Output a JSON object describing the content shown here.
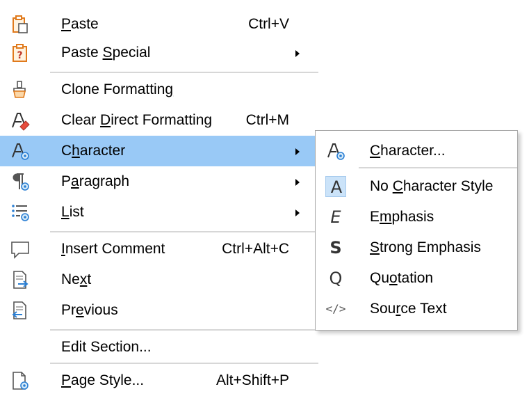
{
  "main_menu": {
    "items": [
      {
        "pre": "",
        "acc": "P",
        "post": "aste",
        "shortcut": "Ctrl+V",
        "icon": "paste-icon",
        "submenu": false
      },
      {
        "pre": "Paste ",
        "acc": "S",
        "post": "pecial",
        "shortcut": "",
        "icon": "paste-special-icon",
        "submenu": true
      },
      {
        "pre": "Clone Formattin",
        "acc": "g",
        "post": "",
        "shortcut": "",
        "icon": "clone-formatting-icon",
        "submenu": false
      },
      {
        "pre": "Clear ",
        "acc": "D",
        "post": "irect Formatting",
        "shortcut": "Ctrl+M",
        "icon": "clear-formatting-icon",
        "submenu": false
      },
      {
        "pre": "C",
        "acc": "h",
        "post": "aracter",
        "shortcut": "",
        "icon": "character-icon",
        "submenu": true,
        "highlighted": true
      },
      {
        "pre": "P",
        "acc": "a",
        "post": "ragraph",
        "shortcut": "",
        "icon": "paragraph-icon",
        "submenu": true
      },
      {
        "pre": "",
        "acc": "L",
        "post": "ist",
        "shortcut": "",
        "icon": "list-icon",
        "submenu": true
      },
      {
        "pre": "",
        "acc": "I",
        "post": "nsert Comment",
        "shortcut": "Ctrl+Alt+C",
        "icon": "comment-icon",
        "submenu": false
      },
      {
        "pre": "Ne",
        "acc": "x",
        "post": "t",
        "shortcut": "",
        "icon": "next-icon",
        "submenu": false
      },
      {
        "pre": "Pr",
        "acc": "e",
        "post": "vious",
        "shortcut": "",
        "icon": "previous-icon",
        "submenu": false
      },
      {
        "pre": "Edit Section...",
        "acc": "",
        "post": "",
        "shortcut": "",
        "icon": "",
        "submenu": false
      },
      {
        "pre": "",
        "acc": "P",
        "post": "age Style...",
        "shortcut": "Alt+Shift+P",
        "icon": "page-style-icon",
        "submenu": false
      }
    ]
  },
  "submenu": {
    "items": [
      {
        "pre": "",
        "acc": "C",
        "post": "haracter...",
        "icon": "character-dialog-icon",
        "glyph": ""
      },
      {
        "pre": "No ",
        "acc": "C",
        "post": "haracter Style",
        "icon": "no-style-icon",
        "glyph": "A"
      },
      {
        "pre": "E",
        "acc": "m",
        "post": "phasis",
        "icon": "emphasis-icon",
        "glyph": "E"
      },
      {
        "pre": "",
        "acc": "S",
        "post": "trong Emphasis",
        "icon": "strong-emphasis-icon",
        "glyph": "S"
      },
      {
        "pre": "Qu",
        "acc": "o",
        "post": "tation",
        "icon": "quotation-icon",
        "glyph": "Q"
      },
      {
        "pre": "Sou",
        "acc": "r",
        "post": "ce Text",
        "icon": "source-text-icon",
        "glyph": "</>"
      }
    ]
  },
  "colors": {
    "highlight": "#99c9f6",
    "separator": "#d7d7d7",
    "accent_blue": "#2a7fd4",
    "icon_orange": "#e07a1c"
  }
}
